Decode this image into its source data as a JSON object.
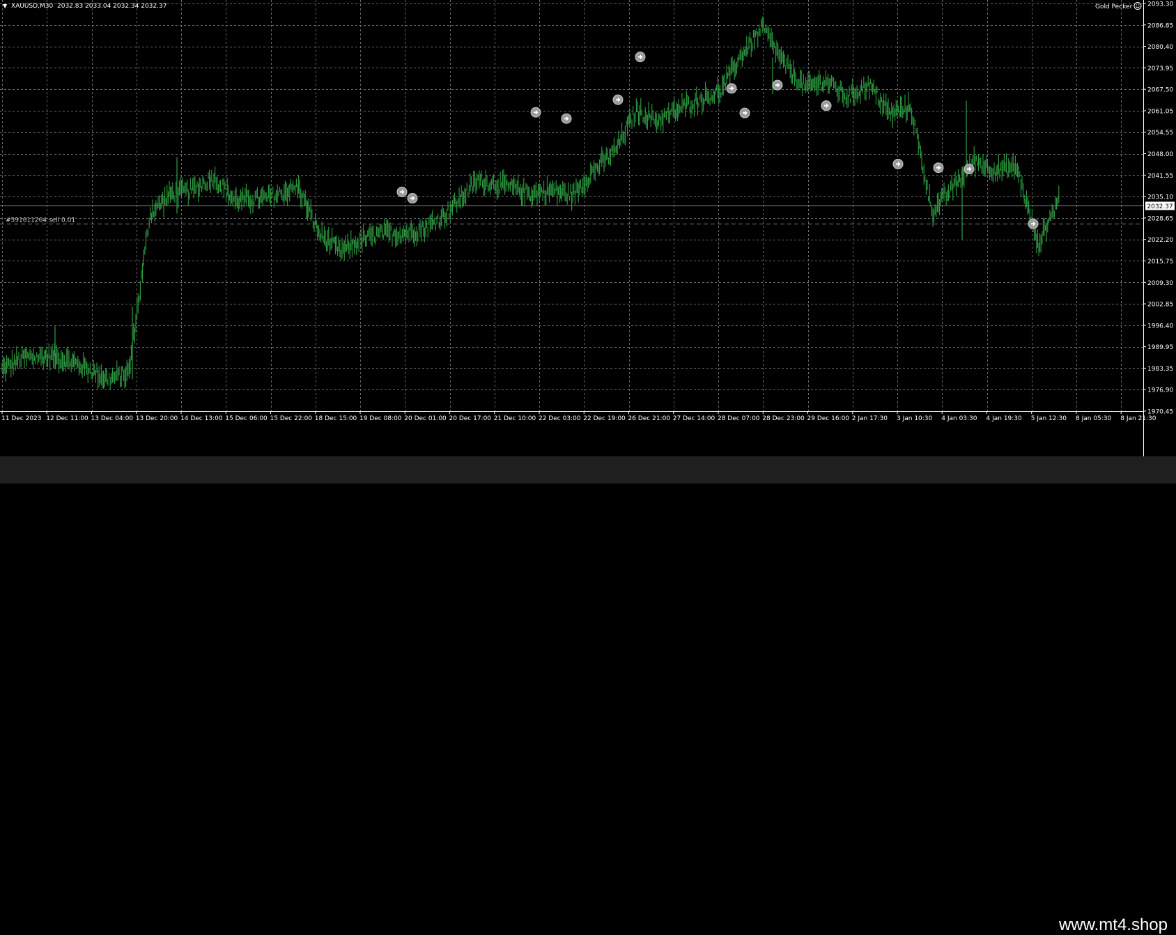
{
  "header": {
    "symbol": "XAUUSD,M30",
    "ohlc": "2032.83 2033.04 2032.34 2032.37",
    "ea_label": "Gold Pecker"
  },
  "order_line_label": "#591611264 sell 0.01",
  "current_price_label": "2032.37",
  "footer": {
    "watermark": "www.mt4.shop"
  },
  "colors": {
    "candles": "#2ea043",
    "grid": "#6b6b6b",
    "background": "#000000",
    "order_line": "#7f7f7f"
  },
  "chart_data": {
    "type": "line",
    "title": "",
    "ylim": [
      1970.45,
      2093.3
    ],
    "y_ticks": [
      "2093.30",
      "2086.85",
      "2080.40",
      "2073.95",
      "2067.50",
      "2061.05",
      "2054.55",
      "2048.00",
      "2041.55",
      "2035.10",
      "2028.65",
      "2022.20",
      "2015.75",
      "2009.30",
      "2002.85",
      "1996.40",
      "1989.95",
      "1983.35",
      "1976.90",
      "1970.45"
    ],
    "x_ticks": [
      "11 Dec 2023",
      "12 Dec 11:00",
      "13 Dec 04:00",
      "13 Dec 20:00",
      "14 Dec 13:00",
      "15 Dec 06:00",
      "15 Dec 22:00",
      "18 Dec 15:00",
      "19 Dec 08:00",
      "20 Dec 01:00",
      "20 Dec 17:00",
      "21 Dec 10:00",
      "22 Dec 03:00",
      "22 Dec 19:00",
      "26 Dec 21:00",
      "27 Dec 14:00",
      "28 Dec 07:00",
      "28 Dec 23:00",
      "29 Dec 16:00",
      "2 Jan 17:30",
      "3 Jan 10:30",
      "4 Jan 03:30",
      "4 Jan 19:30",
      "5 Jan 12:30",
      "8 Jan 05:30",
      "8 Jan 21:30"
    ],
    "x": [
      0,
      2,
      5,
      8,
      10,
      12,
      14,
      16,
      18,
      20,
      22,
      25,
      28,
      30,
      32,
      34,
      36,
      38,
      40,
      42,
      45,
      48,
      50,
      52,
      54,
      56,
      58,
      60,
      62,
      65,
      68,
      70,
      72,
      74,
      76,
      78,
      80,
      82,
      84,
      86,
      88,
      90,
      92,
      94,
      96,
      98,
      100
    ],
    "series": [
      {
        "values": [
          1983.0,
          1986.5,
          1987.0,
          1983.5,
          1980.0,
          1982.0,
          2030.0,
          2036.0,
          2037.0,
          2041.0,
          2034.0,
          2034.5,
          2038.0,
          2024.0,
          2018.5,
          2022.0,
          2024.0,
          2024.0,
          2025.5,
          2030.0,
          2040.0,
          2038.0,
          2036.0,
          2037.0,
          2035.5,
          2043.0,
          2049.0,
          2061.0,
          2058.0,
          2063.0,
          2067.0,
          2078.0,
          2086.0,
          2075.0,
          2068.0,
          2070.0,
          2065.0,
          2069.0,
          2060.0,
          2062.0,
          2030.5,
          2038.0,
          2046.0,
          2043.0,
          2044.0,
          2020.5,
          2034.5
        ]
      }
    ],
    "trade_markers_y": [
      2036.5,
      2034.6,
      2060.5,
      2058.6,
      2064.3,
      2077.2,
      2067.7,
      2060.3,
      2068.7,
      2062.5,
      2044.9,
      2043.8,
      2043.4,
      2026.9
    ],
    "current_price": 2032.37,
    "order_line_price": 2027.0,
    "grid": true
  }
}
